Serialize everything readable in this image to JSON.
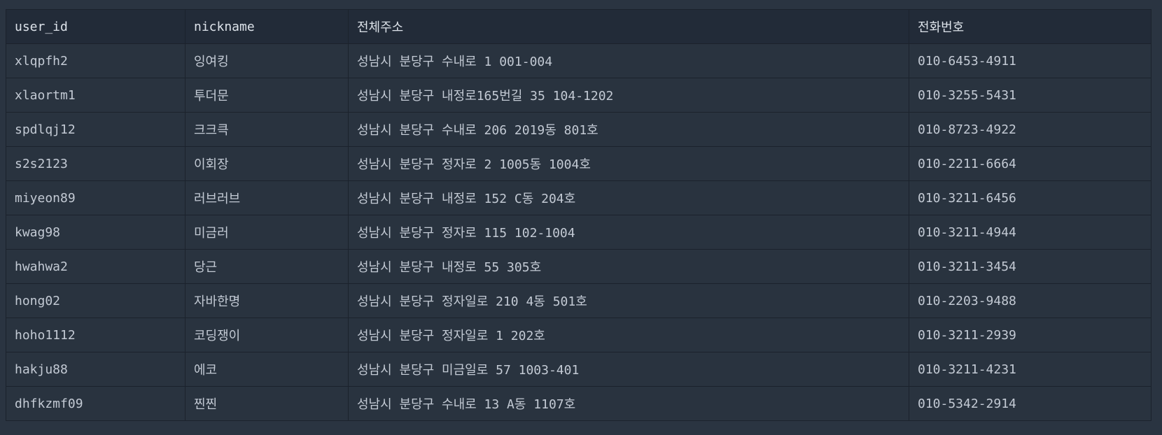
{
  "table": {
    "headers": [
      "user_id",
      "nickname",
      "전체주소",
      "전화번호"
    ],
    "rows": [
      [
        "xlqpfh2",
        "잉여킹",
        "성남시 분당구 수내로 1 001-004",
        "010-6453-4911"
      ],
      [
        "xlaortm1",
        "투더문",
        "성남시 분당구 내정로165번길 35 104-1202",
        "010-3255-5431"
      ],
      [
        "spdlqj12",
        "크크큭",
        "성남시 분당구 수내로 206 2019동 801호",
        "010-8723-4922"
      ],
      [
        "s2s2123",
        "이회장",
        "성남시 분당구 정자로 2 1005동 1004호",
        "010-2211-6664"
      ],
      [
        "miyeon89",
        "러브러브",
        "성남시 분당구 내정로 152 C동 204호",
        "010-3211-6456"
      ],
      [
        "kwag98",
        "미금러",
        "성남시 분당구 정자로 115 102-1004",
        "010-3211-4944"
      ],
      [
        "hwahwa2",
        "당근",
        "성남시 분당구 내정로 55 305호",
        "010-3211-3454"
      ],
      [
        "hong02",
        "자바한명",
        "성남시 분당구 정자일로 210 4동 501호",
        "010-2203-9488"
      ],
      [
        "hoho1112",
        "코딩쟁이",
        "성남시 분당구 정자일로 1 202호",
        "010-3211-2939"
      ],
      [
        "hakju88",
        "에코",
        "성남시 분당구 미금일로 57 1003-401",
        "010-3211-4231"
      ],
      [
        "dhfkzmf09",
        "찐찐",
        "성남시 분당구 수내로 13 A동 1107호",
        "010-5342-2914"
      ]
    ]
  }
}
